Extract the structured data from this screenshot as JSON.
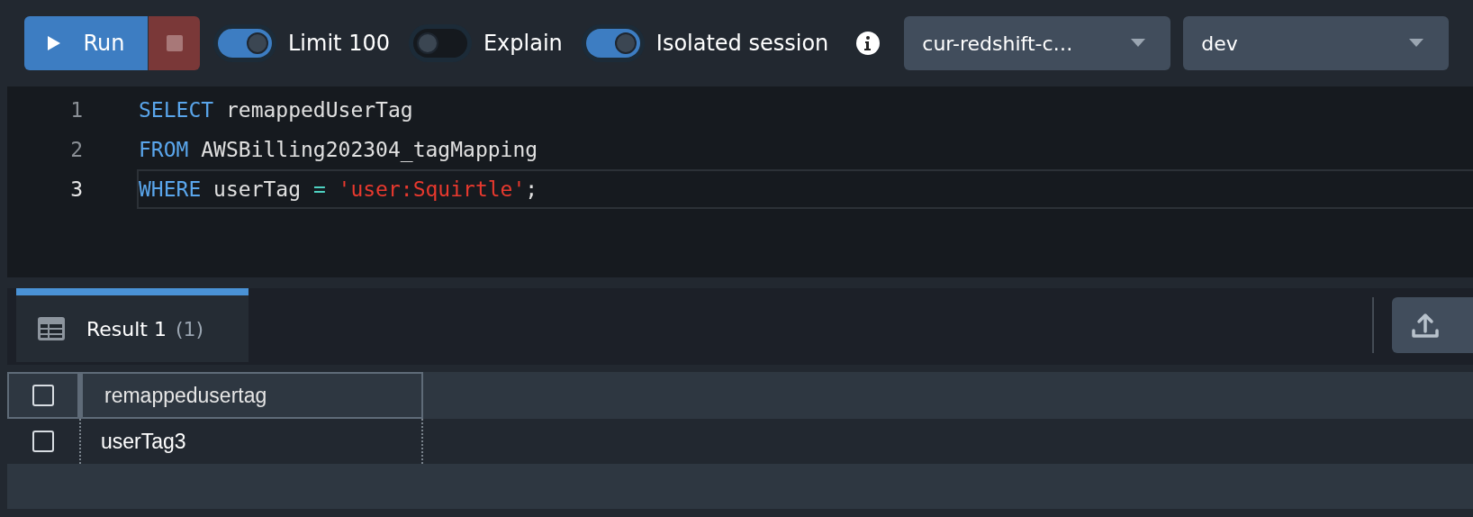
{
  "toolbar": {
    "run_label": "Run",
    "toggles": [
      {
        "label": "Limit 100",
        "on": true
      },
      {
        "label": "Explain",
        "on": false
      },
      {
        "label": "Isolated session",
        "on": true
      }
    ],
    "dropdowns": [
      {
        "value": "cur-redshift-c…"
      },
      {
        "value": "dev"
      }
    ]
  },
  "editor": {
    "lines": [
      {
        "number": "1",
        "current": false,
        "tokens": [
          {
            "kind": "keyword",
            "text": "SELECT"
          },
          {
            "kind": "ident",
            "text": " remappedUserTag"
          }
        ]
      },
      {
        "number": "2",
        "current": false,
        "tokens": [
          {
            "kind": "keyword",
            "text": "FROM"
          },
          {
            "kind": "ident",
            "text": " AWSBilling202304_tagMapping"
          }
        ]
      },
      {
        "number": "3",
        "current": true,
        "tokens": [
          {
            "kind": "keyword",
            "text": "WHERE"
          },
          {
            "kind": "ident",
            "text": " userTag "
          },
          {
            "kind": "op",
            "text": "="
          },
          {
            "kind": "string",
            "text": " 'user:Squirtle'"
          },
          {
            "kind": "ident",
            "text": ";"
          }
        ]
      }
    ]
  },
  "results": {
    "tabs": [
      {
        "label": "Result 1",
        "count": "(1)",
        "selected": true
      }
    ],
    "table": {
      "header_checked": false,
      "columns": [
        "remappedusertag"
      ],
      "rows": [
        {
          "checked": false,
          "cells": [
            "userTag3"
          ]
        }
      ]
    }
  }
}
